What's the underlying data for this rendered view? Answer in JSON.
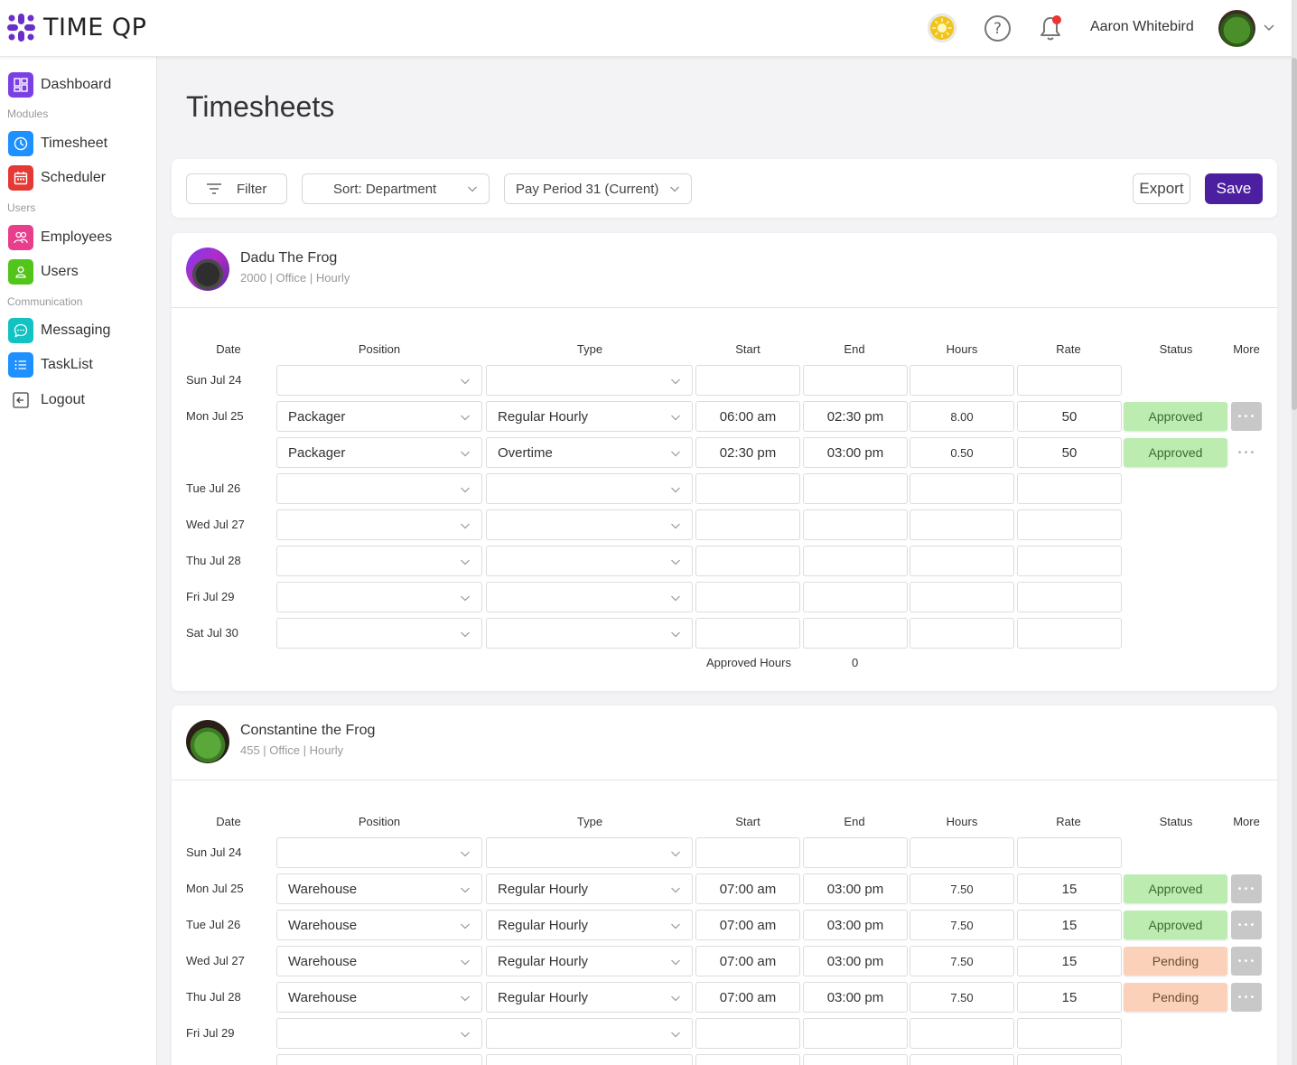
{
  "app": {
    "brand": "TIME QP",
    "user_name": "Aaron Whitebird",
    "accent_color": "#4c1fa0"
  },
  "sidebar": {
    "items": [
      {
        "label": "Dashboard",
        "icon": "dashboard-icon",
        "color": "#7b3fe4"
      },
      {
        "label": "Timesheet",
        "icon": "clock-icon",
        "color": "#1e90ff"
      },
      {
        "label": "Scheduler",
        "icon": "calendar-icon",
        "color": "#e53935"
      },
      {
        "label": "Employees",
        "icon": "people-icon",
        "color": "#e83e8c"
      },
      {
        "label": "Users",
        "icon": "user-icon",
        "color": "#52c41a"
      },
      {
        "label": "Messaging",
        "icon": "chat-icon",
        "color": "#13c2c2"
      },
      {
        "label": "TaskList",
        "icon": "list-icon",
        "color": "#1e90ff"
      },
      {
        "label": "Logout",
        "icon": "logout-icon",
        "color": "#ffffff"
      }
    ],
    "sections": {
      "modules": "Modules",
      "users": "Users",
      "communication": "Communication"
    }
  },
  "page": {
    "title": "Timesheets"
  },
  "toolbar": {
    "filter_label": "Filter",
    "sort_label": "Sort: Department",
    "period_label": "Pay Period 31 (Current)",
    "export_label": "Export",
    "save_label": "Save"
  },
  "columns": [
    "Date",
    "Position",
    "Type",
    "Start",
    "End",
    "Hours",
    "Rate",
    "Status",
    "More"
  ],
  "employees": [
    {
      "name": "Dadu The Frog",
      "meta": "2000 | Office | Hourly",
      "rows": [
        {
          "date": "Sun Jul 24",
          "position": "",
          "type": "",
          "start": "",
          "end": "",
          "hours": "",
          "rate": "",
          "status": ""
        },
        {
          "date": "Mon Jul 25",
          "position": "Packager",
          "type": "Regular Hourly",
          "start": "06:00 am",
          "end": "02:30 pm",
          "hours": "8.00",
          "rate": "50",
          "status": "Approved"
        },
        {
          "date": "",
          "position": "Packager",
          "type": "Overtime",
          "start": "02:30 pm",
          "end": "03:00 pm",
          "hours": "0.50",
          "rate": "50",
          "status": "Approved"
        },
        {
          "date": "Tue Jul 26",
          "position": "",
          "type": "",
          "start": "",
          "end": "",
          "hours": "",
          "rate": "",
          "status": ""
        },
        {
          "date": "Wed Jul 27",
          "position": "",
          "type": "",
          "start": "",
          "end": "",
          "hours": "",
          "rate": "",
          "status": ""
        },
        {
          "date": "Thu Jul 28",
          "position": "",
          "type": "",
          "start": "",
          "end": "",
          "hours": "",
          "rate": "",
          "status": ""
        },
        {
          "date": "Fri Jul 29",
          "position": "",
          "type": "",
          "start": "",
          "end": "",
          "hours": "",
          "rate": "",
          "status": ""
        },
        {
          "date": "Sat Jul 30",
          "position": "",
          "type": "",
          "start": "",
          "end": "",
          "hours": "",
          "rate": "",
          "status": ""
        }
      ],
      "approved_label": "Approved Hours",
      "approved_value": "0"
    },
    {
      "name": "Constantine the Frog",
      "meta": "455 | Office | Hourly",
      "rows": [
        {
          "date": "Sun Jul 24",
          "position": "",
          "type": "",
          "start": "",
          "end": "",
          "hours": "",
          "rate": "",
          "status": ""
        },
        {
          "date": "Mon Jul 25",
          "position": "Warehouse",
          "type": "Regular Hourly",
          "start": "07:00 am",
          "end": "03:00 pm",
          "hours": "7.50",
          "rate": "15",
          "status": "Approved"
        },
        {
          "date": "Tue Jul 26",
          "position": "Warehouse",
          "type": "Regular Hourly",
          "start": "07:00 am",
          "end": "03:00 pm",
          "hours": "7.50",
          "rate": "15",
          "status": "Approved"
        },
        {
          "date": "Wed Jul 27",
          "position": "Warehouse",
          "type": "Regular Hourly",
          "start": "07:00 am",
          "end": "03:00 pm",
          "hours": "7.50",
          "rate": "15",
          "status": "Pending"
        },
        {
          "date": "Thu Jul 28",
          "position": "Warehouse",
          "type": "Regular Hourly",
          "start": "07:00 am",
          "end": "03:00 pm",
          "hours": "7.50",
          "rate": "15",
          "status": "Pending"
        },
        {
          "date": "Fri Jul 29",
          "position": "",
          "type": "",
          "start": "",
          "end": "",
          "hours": "",
          "rate": "",
          "status": ""
        },
        {
          "date": "",
          "position": "",
          "type": "",
          "start": "",
          "end": "",
          "hours": "",
          "rate": "",
          "status": ""
        }
      ]
    }
  ]
}
